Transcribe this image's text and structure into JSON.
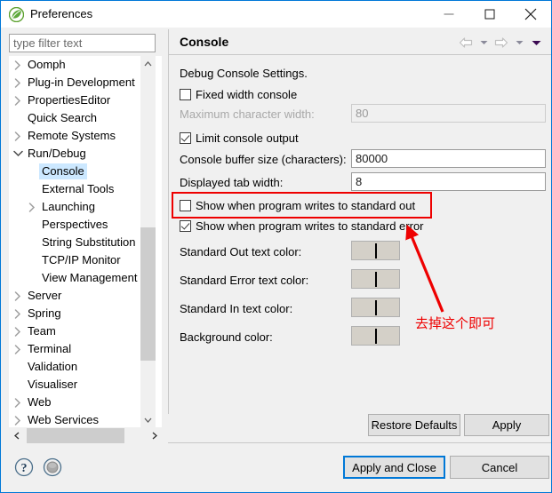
{
  "window": {
    "title": "Preferences",
    "logo_icon": "eclipse-leaf-icon",
    "minimize_label": "Minimize",
    "maximize_label": "Maximize",
    "close_label": "Close"
  },
  "sidebar": {
    "filter": {
      "placeholder": "type filter text",
      "value": ""
    },
    "tree": [
      {
        "label": "Oomph",
        "level": 1,
        "twisty": "collapsed",
        "selected": false
      },
      {
        "label": "Plug-in Development",
        "level": 1,
        "twisty": "collapsed",
        "selected": false
      },
      {
        "label": "PropertiesEditor",
        "level": 1,
        "twisty": "collapsed",
        "selected": false
      },
      {
        "label": "Quick Search",
        "level": 1,
        "twisty": "none",
        "selected": false
      },
      {
        "label": "Remote Systems",
        "level": 1,
        "twisty": "collapsed",
        "selected": false
      },
      {
        "label": "Run/Debug",
        "level": 1,
        "twisty": "expanded",
        "selected": false
      },
      {
        "label": "Console",
        "level": 2,
        "twisty": "none",
        "selected": true
      },
      {
        "label": "External Tools",
        "level": 2,
        "twisty": "none",
        "selected": false
      },
      {
        "label": "Launching",
        "level": 2,
        "twisty": "collapsed",
        "selected": false
      },
      {
        "label": "Perspectives",
        "level": 2,
        "twisty": "none",
        "selected": false
      },
      {
        "label": "String Substitution",
        "level": 2,
        "twisty": "none",
        "selected": false
      },
      {
        "label": "TCP/IP Monitor",
        "level": 2,
        "twisty": "none",
        "selected": false
      },
      {
        "label": "View Management",
        "level": 2,
        "twisty": "none",
        "selected": false
      },
      {
        "label": "Server",
        "level": 1,
        "twisty": "collapsed",
        "selected": false
      },
      {
        "label": "Spring",
        "level": 1,
        "twisty": "collapsed",
        "selected": false
      },
      {
        "label": "Team",
        "level": 1,
        "twisty": "collapsed",
        "selected": false
      },
      {
        "label": "Terminal",
        "level": 1,
        "twisty": "collapsed",
        "selected": false
      },
      {
        "label": "Validation",
        "level": 1,
        "twisty": "none",
        "selected": false
      },
      {
        "label": "Visualiser",
        "level": 1,
        "twisty": "none",
        "selected": false
      },
      {
        "label": "Web",
        "level": 1,
        "twisty": "collapsed",
        "selected": false
      },
      {
        "label": "Web Services",
        "level": 1,
        "twisty": "collapsed",
        "selected": false
      }
    ]
  },
  "content": {
    "title": "Console",
    "nav": {
      "back_icon": "arrow-left-icon",
      "back_caret_icon": "chevron-down-icon",
      "forward_icon": "arrow-right-icon",
      "forward_caret_icon": "chevron-down-icon",
      "menu_icon": "chevron-down-icon"
    },
    "group_label": "Debug Console Settings.",
    "fixed_width_console": {
      "label": "Fixed width console",
      "checked": false
    },
    "max_char_width": {
      "label": "Maximum character width:",
      "value": "80",
      "disabled": true
    },
    "limit_console_output": {
      "label": "Limit console output",
      "checked": true
    },
    "console_buffer_size": {
      "label": "Console buffer size (characters):",
      "value": "80000"
    },
    "displayed_tab_width": {
      "label": "Displayed tab width:",
      "value": "8"
    },
    "show_standard_out": {
      "label": "Show when program writes to standard out",
      "checked": false
    },
    "show_standard_error": {
      "label": "Show when program writes to standard error",
      "checked": true
    },
    "colors": [
      {
        "label": "Standard Out text color:",
        "color": "#000000"
      },
      {
        "label": "Standard Error text color:",
        "color": "#FF0000"
      },
      {
        "label": "Standard In text color:",
        "color": "#00C87A"
      },
      {
        "label": "Background color:",
        "color": "#FFFFFF"
      }
    ]
  },
  "annotation": {
    "color": "#EE0000",
    "text": "去掉这个即可",
    "highlight_target": "show-standard-out-checkbox",
    "arrow_points_to": "show-standard-error-checkbox"
  },
  "footer": {
    "restore_defaults": "Restore Defaults",
    "apply": "Apply",
    "apply_and_close": "Apply and Close",
    "cancel": "Cancel",
    "help_icon": "question-mark-icon",
    "resize_icon": "resize-grip-icon"
  }
}
